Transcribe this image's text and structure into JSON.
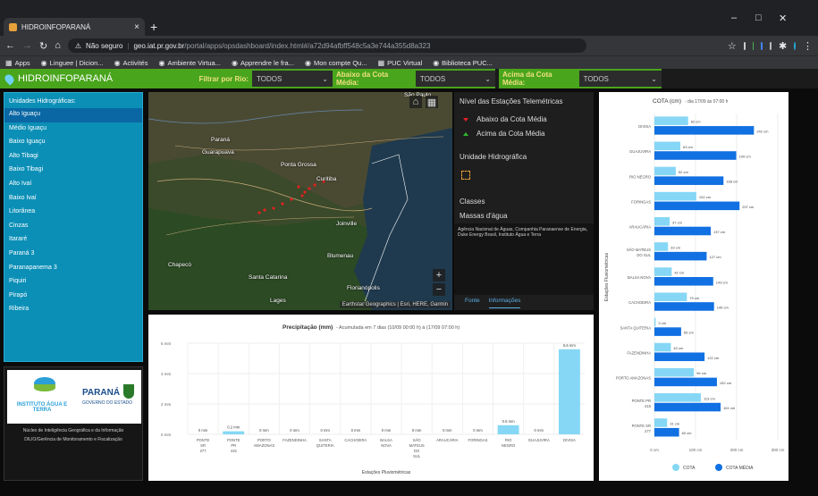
{
  "browser": {
    "tab_title": "HIDROINFOPARANÁ",
    "url_security": "Não seguro",
    "url_host": "geo.iat.pr.gov.br",
    "url_path": "/portal/apps/opsdashboard/index.html#/a72d94afbff548c5a3e744a355d8a323"
  },
  "bookmarks": [
    "Apps",
    "Linguee | Dicion...",
    "Activités",
    "Ambiente Virtua...",
    "Apprendre le fra...",
    "Mon compte Qu...",
    "PUC Virtual",
    "Biblioteca PUC..."
  ],
  "header": {
    "title": "HIDROINFOPARANÁ",
    "filter_rio_label": "Filtrar por Rio:",
    "filter_rio_value": "TODOS",
    "filter_abaixo_label": "Abaixo da Cota Média:",
    "filter_abaixo_value": "TODOS",
    "filter_acima_label": "Acima da Cota Média:",
    "filter_acima_value": "TODOS"
  },
  "sidebar": {
    "title": "Unidades Hidrográficas:",
    "items": [
      "Alto Iguaçu",
      "Médio Iguaçu",
      "Baixo Iguaçu",
      "Alto Tibagi",
      "Baixo Tibagi",
      "Alto Ivaí",
      "Baixo Ivaí",
      "Litorânea",
      "Cinzas",
      "Itararé",
      "Paraná 3",
      "Paranapanema 3",
      "Piquiri",
      "Pirapó",
      "Ribeira"
    ]
  },
  "logo": {
    "institute": "INSTITUTO ÁGUA E TERRA",
    "state": "PARANÁ",
    "state_sub": "GOVERNO DO ESTADO",
    "caption1": "Núcleo de Inteligência Geográfica e da Informação",
    "caption2": "DILIO/Gerência de Monitoramento e Fiscalização"
  },
  "map": {
    "labels": [
      "São Paulo",
      "Paraná",
      "Ponta Grossa",
      "Curitiba",
      "Guarapuava",
      "Joinville",
      "Blumenau",
      "Chapecó",
      "Santa Catarina",
      "Florianópolis",
      "Lages"
    ],
    "attribution": "Earthstar Geographics | Esri, HERE, Garmin"
  },
  "legend": {
    "title": "Nível das Estações Telemétricas",
    "abaixo": "Abaixo da Cota Média",
    "acima": "Acima da Cota Média",
    "unidade": "Unidade Hidrográfica",
    "classes": "Classes",
    "massas": "Massas d'água",
    "sources": "Agência Nacional de Águas, Companhia Paranaense de Energia, Duke Energy Brasil, Instituto Água e Terra",
    "tab_fonte": "Fonte",
    "tab_info": "Informações"
  },
  "colors": {
    "green": "#49a51c",
    "sidebar": "#0b8fb7",
    "cota": "#86d7f5",
    "cota_media": "#1170e2",
    "abaixo": "#e02020",
    "acima": "#2fb82f"
  },
  "chart_data": [
    {
      "type": "bar",
      "title": "Precipitação (mm)",
      "subtitle": "- Acumulada em 7 dias (10/09 00:00 h) à (17/09 07:00 h)",
      "xlabel": "Estações Pluviométricas",
      "yticks": [
        "0 mm",
        "2 mm",
        "4 mm",
        "6 mm"
      ],
      "ylim": [
        0,
        6
      ],
      "categories": [
        "PONTE SR 277",
        "PONTE PR 415",
        "PORTO AMAZONAS",
        "FAZENDINHA",
        "SANTA QUITERIA",
        "CACHOEIRA",
        "BALSA NOVA",
        "SÃO MATEUS DO SUL",
        "ARAUCÁRIA",
        "FORINGAS",
        "RIO NEGRO",
        "GUAJUVIRA",
        "DIVISA"
      ],
      "values": [
        0,
        0.2,
        0,
        0,
        0,
        0,
        0,
        0,
        0,
        0,
        0.6,
        0,
        5.6
      ],
      "data_labels": [
        "0 mm",
        "0.2 mm",
        "0 mm",
        "0 mm",
        "0 mm",
        "0 mm",
        "0 mm",
        "0 mm",
        "0 mm",
        "0 mm",
        "0.6 mm",
        "0 mm",
        "5.6 mm"
      ]
    },
    {
      "type": "bar",
      "orientation": "horizontal",
      "title": "COTA (cm)",
      "subtitle": "- dia 17/09 às 07:00 h",
      "ylabel": "Estações Fluviométricas",
      "xticks": [
        "0 cm",
        "100 cm",
        "200 cm",
        "300 cm"
      ],
      "xlim": [
        0,
        300
      ],
      "categories": [
        "DIVISA",
        "GUAJUVIRA",
        "RIO NEGRO",
        "FORINGAS",
        "ARAUCÁRIA",
        "SÃO MATEUS DO SUL",
        "BALSA NOVA",
        "CACHOEIRA",
        "SANTA QUITERIA",
        "FAZENDINHA",
        "PORTO AMAZONAS",
        "PONTE PR 415",
        "PONTE SR 277"
      ],
      "series": [
        {
          "name": "COTA",
          "values": [
            82,
            63,
            52,
            102,
            37,
            33,
            42,
            79,
            3,
            40,
            96,
            113,
            31
          ],
          "labels": [
            "82 cm",
            "63 cm",
            "52 cm",
            "102 cm",
            "37 cm",
            "33 cm",
            "42 cm",
            "79 cm",
            "3 cm",
            "40 cm",
            "96 cm",
            "113 cm",
            "31 cm"
          ]
        },
        {
          "name": "COTA MÉDIA",
          "values": [
            242,
            199,
            168,
            207,
            137,
            127,
            143,
            145,
            65,
            122,
            152,
            161,
            60
          ],
          "labels": [
            "242 cm",
            "199 cm",
            "168 cm",
            "207 cm",
            "137 cm",
            "127 cm",
            "143 cm",
            "145 cm",
            "65 cm",
            "122 cm",
            "152 cm",
            "161 cm",
            "60 cm"
          ]
        }
      ]
    }
  ]
}
